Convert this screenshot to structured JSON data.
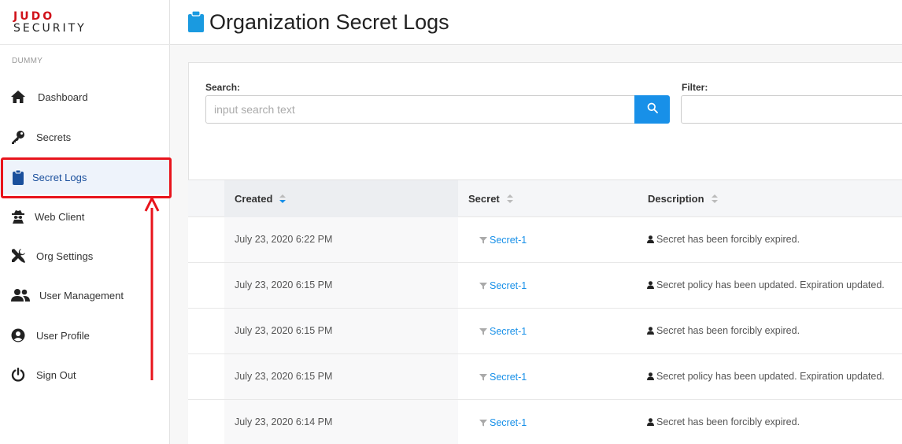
{
  "logo": {
    "line1": "JUDO",
    "line2": "SECURITY"
  },
  "sidebar": {
    "org_name": "DUMMY",
    "items": [
      {
        "label": "Dashboard",
        "icon": "home-icon"
      },
      {
        "label": "Secrets",
        "icon": "key-icon"
      },
      {
        "label": "Secret Logs",
        "icon": "clipboard-icon",
        "active": true
      },
      {
        "label": "Web Client",
        "icon": "spy-icon"
      },
      {
        "label": "Org Settings",
        "icon": "tools-icon"
      },
      {
        "label": "User Management",
        "icon": "users-icon"
      },
      {
        "label": "User Profile",
        "icon": "user-circle-icon"
      },
      {
        "label": "Sign Out",
        "icon": "power-icon"
      }
    ]
  },
  "header": {
    "title": "Organization Secret Logs",
    "icon": "clipboard-icon"
  },
  "search": {
    "label": "Search:",
    "placeholder": "input search text",
    "value": "",
    "button_icon": "search-icon"
  },
  "filter": {
    "label": "Filter:",
    "value": ""
  },
  "table": {
    "columns": [
      {
        "label": "Created",
        "sorted": "descending"
      },
      {
        "label": "Secret"
      },
      {
        "label": "Description"
      }
    ],
    "rows": [
      {
        "created": "July 23, 2020 6:22 PM",
        "secret": "Secret-1",
        "description": "Secret has been forcibly expired."
      },
      {
        "created": "July 23, 2020 6:15 PM",
        "secret": "Secret-1",
        "description": "Secret policy has been updated. Expiration updated."
      },
      {
        "created": "July 23, 2020 6:15 PM",
        "secret": "Secret-1",
        "description": "Secret has been forcibly expired."
      },
      {
        "created": "July 23, 2020 6:15 PM",
        "secret": "Secret-1",
        "description": "Secret policy has been updated. Expiration updated."
      },
      {
        "created": "July 23, 2020 6:14 PM",
        "secret": "Secret-1",
        "description": "Secret has been forcibly expired."
      }
    ]
  },
  "colors": {
    "accent": "#1890e8",
    "brand_red": "#d0121a",
    "annotation": "#e8141c"
  }
}
